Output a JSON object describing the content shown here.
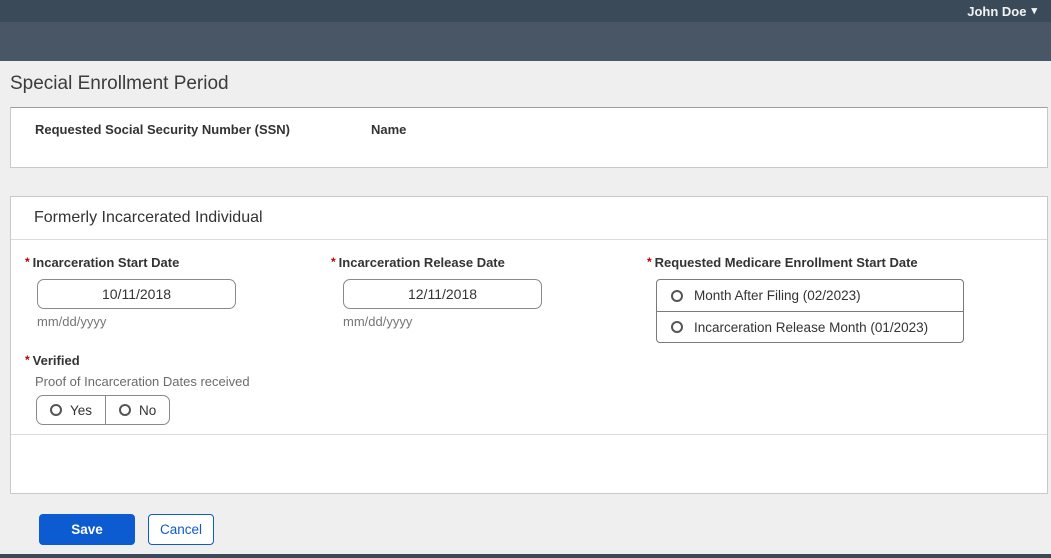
{
  "header": {
    "user_name": "John Doe"
  },
  "icons": {
    "caret_down": "▾"
  },
  "page_title": "Special Enrollment Period",
  "summary_card": {
    "ssn_label": "Requested Social Security Number (SSN)",
    "name_label": "Name"
  },
  "form_card": {
    "title": "Formerly Incarcerated Individual",
    "required_marker": "*",
    "start_date": {
      "label": "Incarceration Start Date",
      "value": "10/11/2018",
      "hint": "mm/dd/yyyy"
    },
    "release_date": {
      "label": "Incarceration Release Date",
      "value": "12/11/2018",
      "hint": "mm/dd/yyyy"
    },
    "enrollment_start": {
      "label": "Requested Medicare Enrollment Start Date",
      "options": [
        {
          "label": "Month After Filing (02/2023)",
          "selected": false
        },
        {
          "label": "Incarceration Release Month (01/2023)",
          "selected": false
        }
      ]
    },
    "verified": {
      "label": "Verified",
      "sublabel": "Proof of Incarceration Dates received",
      "options": [
        {
          "label": "Yes",
          "selected": false
        },
        {
          "label": "No",
          "selected": false
        }
      ]
    }
  },
  "actions": {
    "save_label": "Save",
    "cancel_label": "Cancel"
  },
  "colors": {
    "navbar_top": "#3b4a59",
    "navbar_sub": "#495665",
    "accent_blue": "#0d5bd0",
    "required_red": "#c00000",
    "page_bg": "#efefef"
  }
}
